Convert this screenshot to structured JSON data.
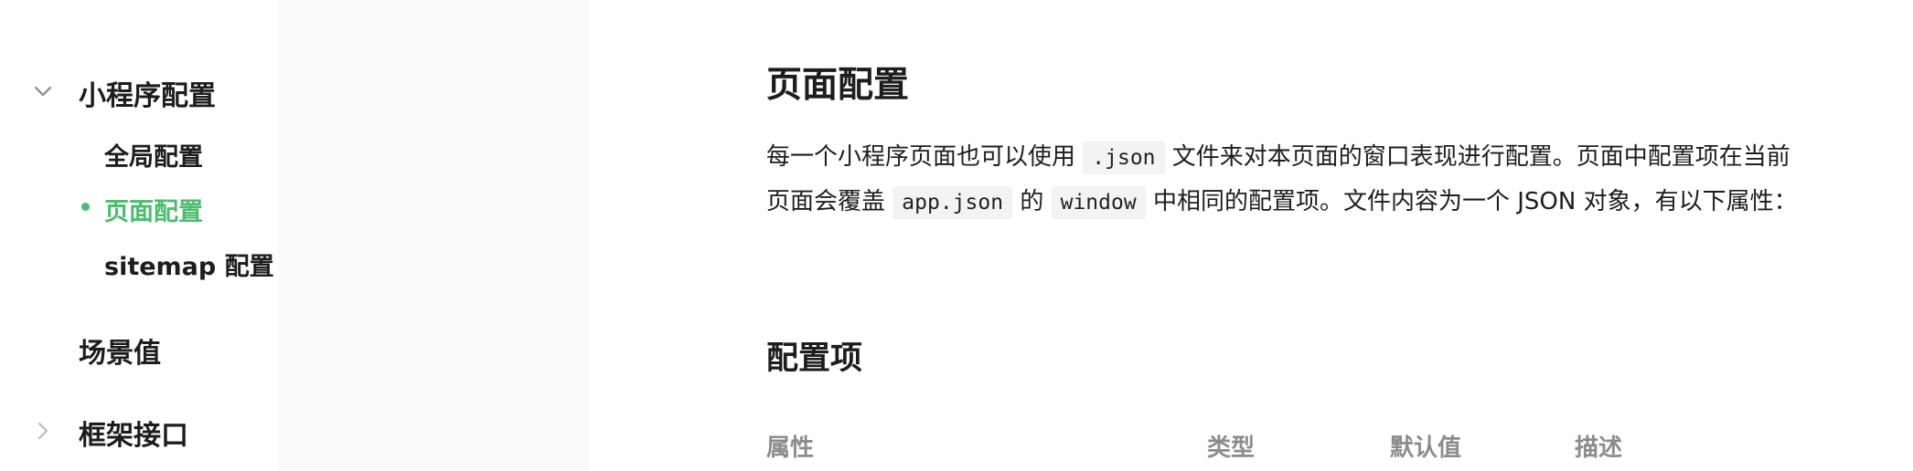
{
  "sidebar": {
    "groups": [
      {
        "label": "小程序配置",
        "expanded": true,
        "items": [
          {
            "label": "全局配置",
            "active": false
          },
          {
            "label": "页面配置",
            "active": true
          },
          {
            "label": "sitemap 配置",
            "active": false
          }
        ]
      },
      {
        "label": "场景值",
        "expanded": null
      },
      {
        "label": "框架接口",
        "expanded": false
      }
    ]
  },
  "main": {
    "title": "页面配置",
    "description": {
      "t1": "每一个小程序页面也可以使用",
      "c1": ".json",
      "t2": "文件来对本页面的窗口表现进行配置。页面中配置项在当前页面会覆盖",
      "c2": "app.json",
      "t3": "的",
      "c3": "window",
      "t4": "中相同的配置项。文件内容为一个 JSON 对象，有以下属性："
    },
    "section_title": "配置项",
    "table_headers": {
      "attr": "属性",
      "type": "类型",
      "default": "默认值",
      "desc": "描述"
    }
  },
  "colors": {
    "accent": "#4bbd6e",
    "text": "#1d1d1d",
    "muted": "#8c8c8c",
    "sidebar_bg": "#fafafa",
    "code_bg": "#f3f3f3"
  },
  "icons": {
    "expanded_group": "chevron-down-icon",
    "collapsed_group": "chevron-right-icon"
  }
}
